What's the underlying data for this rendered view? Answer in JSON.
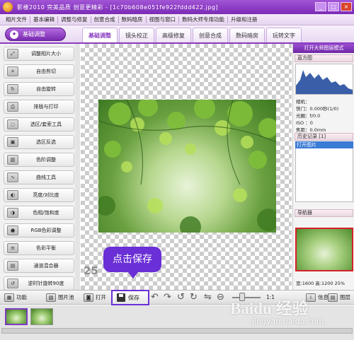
{
  "window": {
    "title": "影楼2010 完美品质 创意更精彩 - [1c70b608e051fe922fddd422.jpg]",
    "controls": [
      "_",
      "□",
      "×"
    ]
  },
  "menu": [
    "相片文件",
    "基本编辑",
    "调整与修复",
    "创意合成",
    "数码暗房",
    "视图与窗口",
    "数码大师专用功能",
    "升级和注册"
  ],
  "toolbar": {
    "basic_button": "基础调整"
  },
  "tabs": [
    "基础调整",
    "镜头校正",
    "高级修复",
    "创意合成",
    "数码暗房",
    "玩转文字"
  ],
  "tools": [
    {
      "label": "调整相片大小",
      "icon": "resize-icon"
    },
    {
      "label": "自由剪切",
      "icon": "crop-icon"
    },
    {
      "label": "自由旋转",
      "icon": "rotate-icon"
    },
    {
      "label": "排版与打印",
      "icon": "print-icon"
    },
    {
      "label": "选区/套索工具",
      "icon": "lasso-icon"
    },
    {
      "label": "选区反选",
      "icon": "invert-selection-icon"
    },
    {
      "label": "色阶调整",
      "icon": "levels-icon"
    },
    {
      "label": "曲线工具",
      "icon": "curves-icon"
    },
    {
      "label": "亮度/对比度",
      "icon": "brightness-icon"
    },
    {
      "label": "色相/饱和度",
      "icon": "hue-icon"
    },
    {
      "label": "RGB色彩调整",
      "icon": "rgb-icon"
    },
    {
      "label": "色彩平衡",
      "icon": "color-balance-icon"
    },
    {
      "label": "通道混合器",
      "icon": "channel-mixer-icon"
    },
    {
      "label": "逆时针旋转90度",
      "icon": "rotate-ccw-icon"
    }
  ],
  "right_panel": {
    "header": "打开大师图层模式",
    "histogram_label": "直方图",
    "camera_info": [
      "相机：",
      "快门：0.000秒(1/0)",
      "光圈：f/0.0",
      "ISO ：0",
      "焦距：0.0mm"
    ],
    "history_label": "历史记录 [1]",
    "history_items": [
      "打开图片"
    ],
    "navigator_label": "导航器",
    "zoom_info": "宽:1600  高:1200  25%"
  },
  "canvas": {
    "zoom_label": "25",
    "callout": "点击保存"
  },
  "bottom_bar": {
    "function_label": "功能",
    "album_label": "图片池",
    "open_label": "打开",
    "save_label": "保存",
    "ratio_label": "1:1",
    "info_label": "信息",
    "layout_label": "图层"
  },
  "watermark": {
    "brand": "Baidu 经验",
    "url": "jingyan.baidu.com"
  }
}
